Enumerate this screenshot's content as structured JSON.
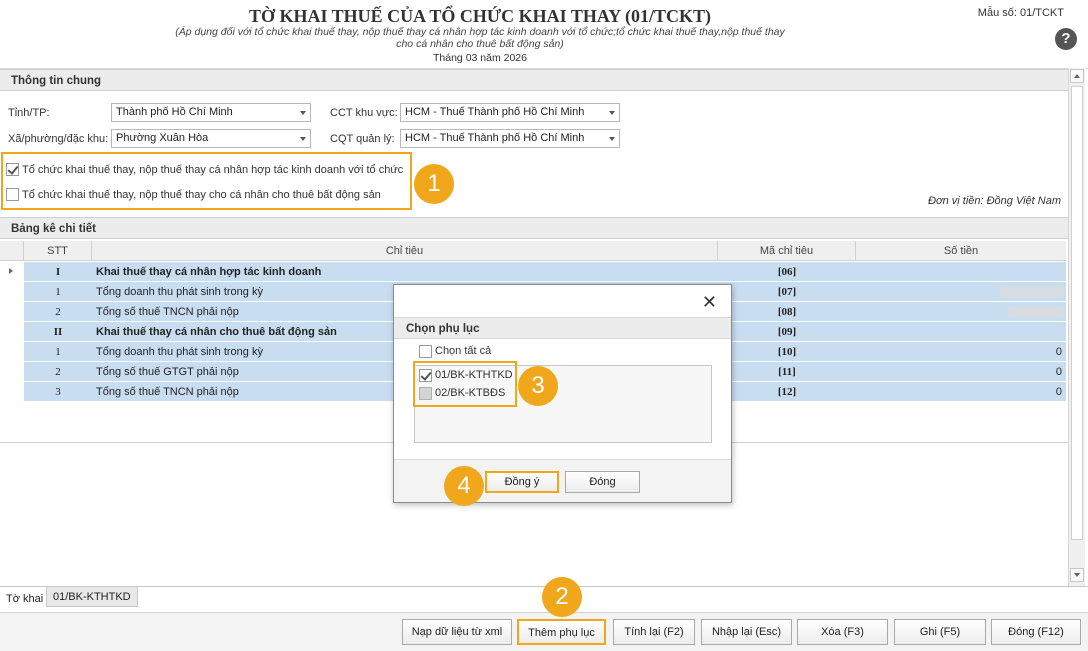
{
  "header": {
    "title": "TỜ KHAI THUẾ CỦA TỔ CHỨC KHAI THAY (01/TCKT)",
    "subtitle_line1": "(Áp dụng đối với tổ chức khai thuế thay, nộp thuế thay cá nhân hợp tác kinh doanh với tổ chức;tổ chức khai thuế thay,nộp thuế thay",
    "subtitle_line2": "cho cá nhân cho thuê bất động sản)",
    "period": "Tháng 03 năm 2026",
    "form_code": "Mẫu số: 01/TCKT",
    "help_symbol": "?"
  },
  "general": {
    "section_title": "Thông tin chung",
    "province_label": "Tỉnh/TP:",
    "province_value": "Thành phố Hồ Chí Minh",
    "ward_label": "Xã/phường/đặc khu:",
    "ward_value": "Phường Xuân Hòa",
    "cct_label": "CCT khu vực:",
    "cct_value": "HCM - Thuế Thành phố Hồ Chí Minh",
    "cqt_label": "CQT quản lý:",
    "cqt_value": "HCM - Thuế Thành phố Hồ Chí Minh",
    "option1_label": "Tổ chức khai thuế thay, nộp thuế thay cá nhân hợp tác kinh doanh với tổ chức",
    "option1_checked": true,
    "option2_label": "Tổ chức khai thuế thay, nộp thuế thay cho cá nhân cho thuê bất động sản",
    "option2_checked": false,
    "currency_note": "Đơn vị tiền: Đồng Việt Nam"
  },
  "detail": {
    "section_title": "Bảng kê chi tiết",
    "columns": [
      "STT",
      "Chỉ tiêu",
      "Mã chỉ tiêu",
      "Số tiền"
    ],
    "rows": [
      {
        "stt": "I",
        "item": "Khai thuế thay cá nhân hợp tác kinh doanh",
        "code": "[06]",
        "amount": ""
      },
      {
        "stt": "1",
        "item": "Tổng doanh thu phát sinh trong kỳ",
        "code": "[07]",
        "amount": ""
      },
      {
        "stt": "2",
        "item": "Tổng số thuế TNCN phải nộp",
        "code": "[08]",
        "amount": ""
      },
      {
        "stt": "II",
        "item": "Khai thuế thay cá nhân cho thuê bất động sản",
        "code": "[09]",
        "amount": ""
      },
      {
        "stt": "1",
        "item": "Tổng doanh thu phát sinh trong kỳ",
        "code": "[10]",
        "amount": "0"
      },
      {
        "stt": "2",
        "item": "Tổng số thuế GTGT phải nộp",
        "code": "[11]",
        "amount": "0"
      },
      {
        "stt": "3",
        "item": "Tổng số thuế TNCN phải nộp",
        "code": "[12]",
        "amount": "0"
      }
    ]
  },
  "tabs": [
    "Tờ khai",
    "01/BK-KTHTKD"
  ],
  "buttons": {
    "import_xml": "Nạp dữ liệu từ xml",
    "add_appendix": "Thêm phụ lục",
    "recalc": "Tính lại (F2)",
    "reenter": "Nhập lại (Esc)",
    "delete": "Xóa (F3)",
    "save": "Ghi (F5)",
    "close": "Đóng (F12)"
  },
  "dialog": {
    "title": "Chọn phụ lục",
    "close_symbol": "✕",
    "select_all_label": "Chọn tất cả",
    "select_all_checked": false,
    "items": [
      {
        "label": "01/BK-KTHTKD",
        "checked": true
      },
      {
        "label": "02/BK-KTBĐS",
        "checked": false
      }
    ],
    "ok_label": "Đồng ý",
    "close_label": "Đóng"
  },
  "callouts": [
    "1",
    "2",
    "3",
    "4"
  ],
  "colors": {
    "accent_orange": "#f0a71c",
    "row_highlight": "#c9ddf1",
    "section_header_bg": "#ececec"
  }
}
